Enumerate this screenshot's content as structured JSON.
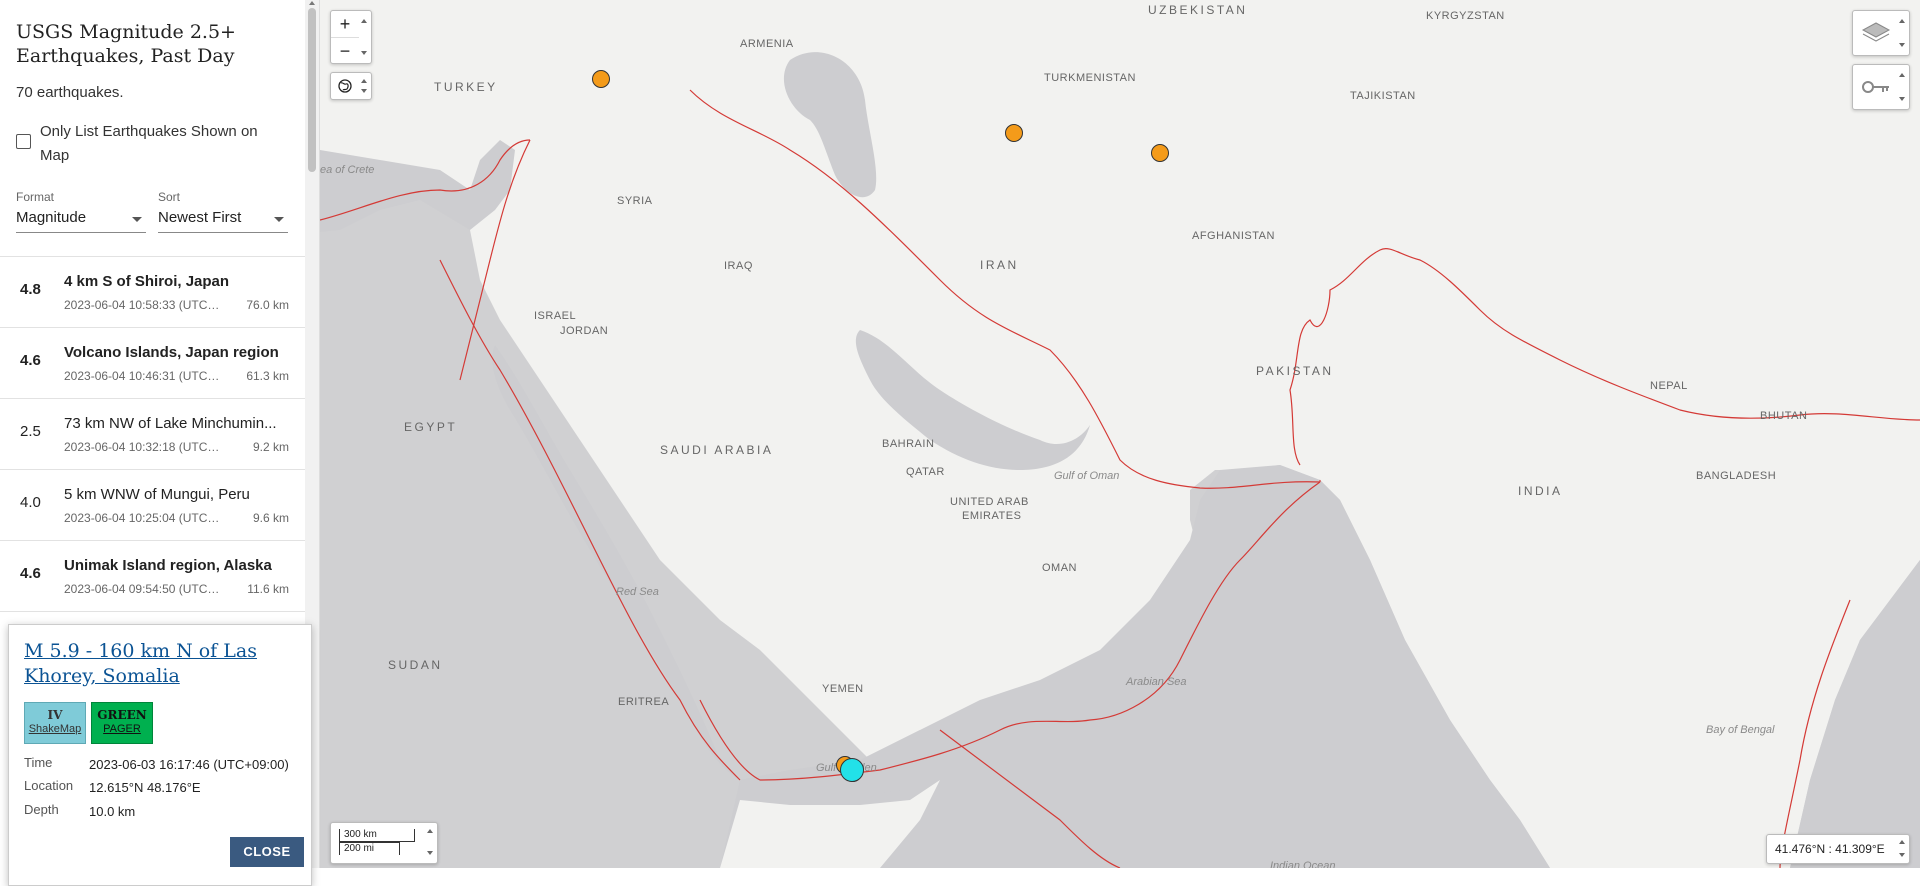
{
  "sidebar": {
    "title": "USGS Magnitude 2.5+ Earthquakes, Past Day",
    "count_text": "70 earthquakes.",
    "only_list_label": "Only List Earthquakes Shown on Map",
    "format": {
      "label": "Format",
      "value": "Magnitude"
    },
    "sort": {
      "label": "Sort",
      "value": "Newest First"
    },
    "earthquakes": [
      {
        "mag": "4.8",
        "place": "4 km S of Shiroi, Japan",
        "time": "2023-06-04 10:58:33 (UTC+0...",
        "depth": "76.0 km"
      },
      {
        "mag": "4.6",
        "place": "Volcano Islands, Japan region",
        "time": "2023-06-04 10:46:31 (UTC+0...",
        "depth": "61.3 km"
      },
      {
        "mag": "2.5",
        "place": "73 km NW of Lake Minchumin...",
        "time": "2023-06-04 10:32:18 (UTC+09:...",
        "depth": "9.2 km"
      },
      {
        "mag": "4.0",
        "place": "5 km WNW of Mungui, Peru",
        "time": "2023-06-04 10:25:04 (UTC+09:...",
        "depth": "9.6 km"
      },
      {
        "mag": "4.6",
        "place": "Unimak Island region, Alaska",
        "time": "2023-06-04 09:54:50 (UTC+0...",
        "depth": "11.6 km"
      }
    ]
  },
  "popup": {
    "title": "M 5.9 - 160 km N of Las Khorey, Somalia",
    "shakemap": {
      "value": "IV",
      "label": "ShakeMap"
    },
    "pager": {
      "value": "GREEN",
      "label": "PAGER"
    },
    "time_label": "Time",
    "time_value": "2023-06-03 16:17:46 (UTC+09:00)",
    "location_label": "Location",
    "location_value": "12.615°N 48.176°E",
    "depth_label": "Depth",
    "depth_value": "10.0 km",
    "close_label": "CLOSE"
  },
  "map": {
    "zoom_in": "+",
    "zoom_out": "−",
    "scale_km": "300 km",
    "scale_mi": "200 mi",
    "coords": "41.476°N : 41.309°E",
    "countries": [
      "UZBEKISTAN",
      "KYRGYZSTAN",
      "ARMENIA",
      "TURKEY",
      "TURKMENISTAN",
      "TAJIKISTAN",
      "SYRIA",
      "IRAQ",
      "IRAN",
      "AFGHANISTAN",
      "ISRAEL",
      "JORDAN",
      "PAKISTAN",
      "NEPAL",
      "BHUTAN",
      "EGYPT",
      "SAUDI ARABIA",
      "BAHRAIN",
      "QATAR",
      "UNITED ARAB",
      "EMIRATES",
      "BANGLADESH",
      "INDIA",
      "OMAN",
      "SUDAN",
      "YEMEN",
      "ERITREA"
    ],
    "seas": [
      "ea of Crete",
      "Gulf of Oman",
      "Red Sea",
      "Arabian Sea",
      "Bay of Bengal",
      "Gulf of Aden",
      "Indian Ocean"
    ],
    "colors": {
      "quake_orange": "#f49b1a",
      "quake_selected": "#22e1e8",
      "plate_boundary": "#d43a36",
      "land": "#f2f2f0",
      "water": "#cdcdd0"
    }
  }
}
